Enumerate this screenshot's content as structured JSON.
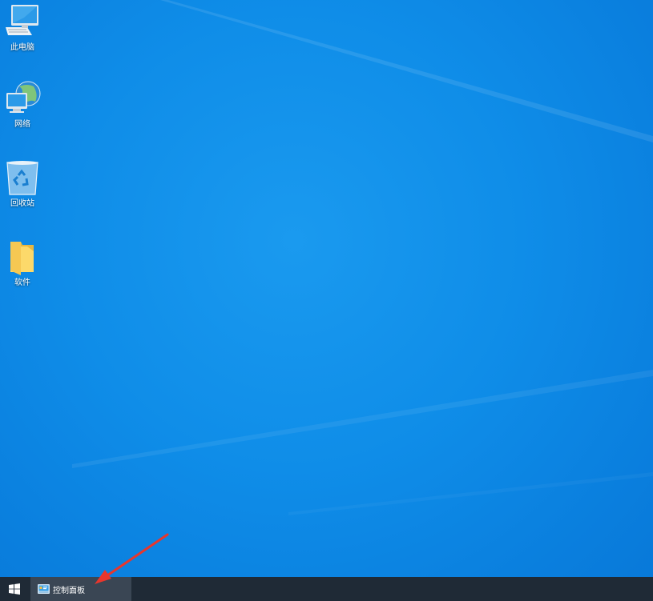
{
  "desktop_icons": [
    {
      "label": "此电脑",
      "icon": "this-pc-icon"
    },
    {
      "label": "网络",
      "icon": "network-icon"
    },
    {
      "label": "回收站",
      "icon": "recycle-bin-icon"
    },
    {
      "label": "软件",
      "icon": "folder-icon"
    }
  ],
  "taskbar": {
    "start_icon": "windows-logo-icon",
    "active_item": {
      "label": "控制面板",
      "icon": "control-panel-icon"
    }
  },
  "annotation": {
    "icon": "red-arrow-annotation"
  },
  "colors": {
    "desktop": "#0f8de8",
    "taskbar": "#1f2a36",
    "task_item": "#3a4654",
    "arrow": "#e8362c"
  }
}
